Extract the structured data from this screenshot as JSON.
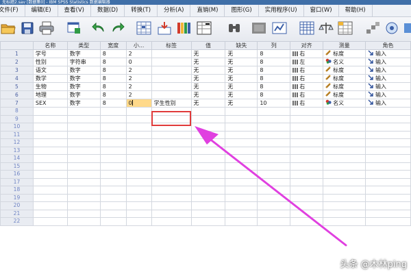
{
  "window": {
    "title": "无标题2.sav [数据集0] - IBM SPSS Statistics 数据编辑器"
  },
  "menu": [
    {
      "label": "文件(F)"
    },
    {
      "label": "编辑(E)"
    },
    {
      "label": "查看(V)"
    },
    {
      "label": "数据(D)"
    },
    {
      "label": "转换(T)"
    },
    {
      "label": "分析(A)"
    },
    {
      "label": "直销(M)"
    },
    {
      "label": "图形(G)"
    },
    {
      "label": "实用程序(U)"
    },
    {
      "label": "窗口(W)"
    },
    {
      "label": "帮助(H)"
    }
  ],
  "toolbar": [
    {
      "icon": "open-folder-icon"
    },
    {
      "icon": "save-icon"
    },
    {
      "icon": "print-icon"
    },
    {
      "icon": "dialog-recall-icon"
    },
    {
      "icon": "undo-icon"
    },
    {
      "icon": "redo-icon"
    },
    {
      "icon": "goto-case-icon"
    },
    {
      "icon": "goto-variable-icon"
    },
    {
      "icon": "variables-icon"
    },
    {
      "icon": "run-descriptives-icon"
    },
    {
      "icon": "find-icon"
    },
    {
      "icon": "insert-cases-icon"
    },
    {
      "icon": "insert-variable-icon"
    },
    {
      "icon": "split-file-icon"
    },
    {
      "icon": "weight-cases-icon"
    },
    {
      "icon": "select-cases-icon"
    },
    {
      "icon": "value-labels-icon"
    },
    {
      "icon": "use-sets-icon"
    },
    {
      "icon": "show-all-variables-icon"
    }
  ],
  "grid": {
    "columns": [
      "名称",
      "类型",
      "宽度",
      "小...",
      "标签",
      "值",
      "缺失",
      "列",
      "对齐",
      "测量",
      "角色"
    ],
    "row_numbers": [
      "1",
      "2",
      "3",
      "4",
      "5",
      "6",
      "7",
      "8",
      "9",
      "10",
      "11",
      "12",
      "13",
      "14",
      "15",
      "16",
      "17",
      "18",
      "19",
      "20",
      "21",
      "22"
    ],
    "rows": [
      {
        "name": "学号",
        "type": "数字",
        "width": "8",
        "decimals": "2",
        "label": "",
        "values": "无",
        "missing": "无",
        "columns": "8",
        "align": "右",
        "measure": "标度",
        "role": "输入"
      },
      {
        "name": "性别",
        "type": "字符串",
        "width": "8",
        "decimals": "0",
        "label": "",
        "values": "无",
        "missing": "无",
        "columns": "8",
        "align": "左",
        "measure": "名义",
        "role": "输入"
      },
      {
        "name": "语文",
        "type": "数字",
        "width": "8",
        "decimals": "2",
        "label": "",
        "values": "无",
        "missing": "无",
        "columns": "8",
        "align": "右",
        "measure": "标度",
        "role": "输入"
      },
      {
        "name": "数学",
        "type": "数字",
        "width": "8",
        "decimals": "2",
        "label": "",
        "values": "无",
        "missing": "无",
        "columns": "8",
        "align": "右",
        "measure": "标度",
        "role": "输入"
      },
      {
        "name": "生物",
        "type": "数字",
        "width": "8",
        "decimals": "2",
        "label": "",
        "values": "无",
        "missing": "无",
        "columns": "8",
        "align": "右",
        "measure": "标度",
        "role": "输入"
      },
      {
        "name": "地理",
        "type": "数字",
        "width": "8",
        "decimals": "2",
        "label": "",
        "values": "无",
        "missing": "无",
        "columns": "8",
        "align": "右",
        "measure": "标度",
        "role": "输入"
      },
      {
        "name": "SEX",
        "type": "数字",
        "width": "8",
        "decimals": "0",
        "label": "学生性别",
        "values": "无",
        "missing": "无",
        "columns": "10",
        "align": "右",
        "measure": "名义",
        "role": "输入"
      }
    ]
  },
  "colors": {
    "highlight_border": "#e03a3a",
    "arrow": "#e040e0",
    "editing_cell": "#ffd98a"
  },
  "watermark": "头条 @木林ping"
}
